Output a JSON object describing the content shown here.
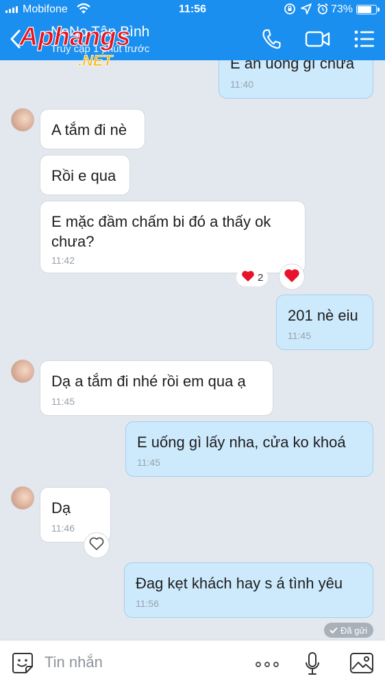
{
  "status_bar": {
    "carrier": "Mobifone",
    "time": "11:56",
    "battery_percent": "73%",
    "battery_level": 0.73,
    "icons": [
      "wifi-icon",
      "screen-lock-icon",
      "location-icon",
      "alarm-icon"
    ]
  },
  "header": {
    "contact_name": "NoNo Tân Bình",
    "status": "Truy cập 1 phút trước",
    "icons": [
      "back-chevron-icon",
      "phone-icon",
      "video-call-icon",
      "menu-list-icon"
    ]
  },
  "watermark": {
    "text": "Aphangs",
    "suffix": ".NET"
  },
  "messages": [
    {
      "side": "out",
      "text": "E ăn uống gì chưa",
      "time": "11:40"
    },
    {
      "side": "in",
      "text": "A tắm đi nè",
      "time": ""
    },
    {
      "side": "in",
      "text": "Rồi e qua",
      "time": ""
    },
    {
      "side": "in",
      "text": "E mặc đầm chấm bi đó a thấy ok chưa?",
      "time": "11:42"
    },
    {
      "side": "out",
      "text": "201 nè eiu",
      "time": "11:45"
    },
    {
      "side": "in",
      "text": "Dạ a tắm đi nhé rồi em qua ạ",
      "time": "11:45"
    },
    {
      "side": "out",
      "text": "E uống gì lấy nha, cửa ko khoá",
      "time": "11:45"
    },
    {
      "side": "in",
      "text": "Dạ",
      "time": "11:46"
    },
    {
      "side": "out",
      "text": "Đag kẹt khách hay s á tình yêu",
      "time": "11:56"
    }
  ],
  "reactions": {
    "msg_4_count": "2",
    "msg_4_icon": "heart-icon",
    "msg_4_react_button": "heart-icon",
    "msg_8_react_button": "heart-outline-icon"
  },
  "send_status": "Đã gửi",
  "composer": {
    "placeholder": "Tin nhắn",
    "icons": [
      "sticker-icon",
      "more-icon",
      "microphone-icon",
      "image-icon"
    ]
  },
  "colors": {
    "header_bg": "#1a8ff0",
    "chat_bg": "#e3e8ee",
    "out_bubble": "#cdeafd",
    "in_bubble": "#ffffff",
    "heart": "#e8132b"
  }
}
